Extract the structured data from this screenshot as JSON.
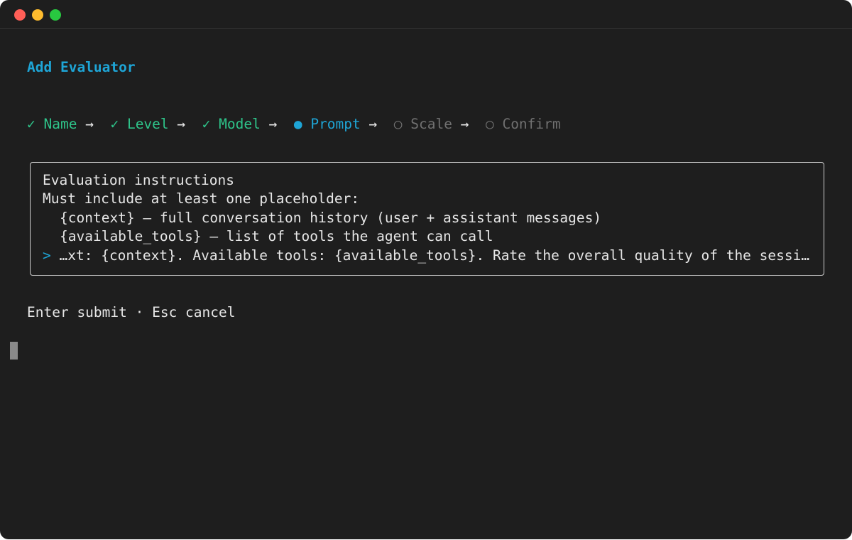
{
  "window": {
    "traffic_lights": [
      "close",
      "minimize",
      "zoom"
    ]
  },
  "header": {
    "title": "Add Evaluator"
  },
  "wizard": {
    "steps": [
      {
        "marker": "✓",
        "label": "Name",
        "status": "done"
      },
      {
        "marker": "✓",
        "label": "Level",
        "status": "done"
      },
      {
        "marker": "✓",
        "label": "Model",
        "status": "done"
      },
      {
        "marker": "●",
        "label": "Prompt",
        "status": "active"
      },
      {
        "marker": "○",
        "label": "Scale",
        "status": "pending"
      },
      {
        "marker": "○",
        "label": "Confirm",
        "status": "pending"
      }
    ],
    "separator": "→"
  },
  "prompt_box": {
    "heading": "Evaluation instructions",
    "hint": "Must include at least one placeholder:",
    "placeholders": [
      "{context} — full conversation history (user + assistant messages)",
      "{available_tools} — list of tools the agent can call"
    ],
    "input_marker": ">",
    "input_value": "…xt: {context}. Available tools: {available_tools}. Rate the overall quality of the sessi…"
  },
  "footer": {
    "help_text": "Enter submit · Esc cancel"
  },
  "colors": {
    "background": "#1e1e1e",
    "accent": "#1ea5d6",
    "done": "#2ec48a",
    "pending": "#707070",
    "text": "#e6e6e6"
  }
}
